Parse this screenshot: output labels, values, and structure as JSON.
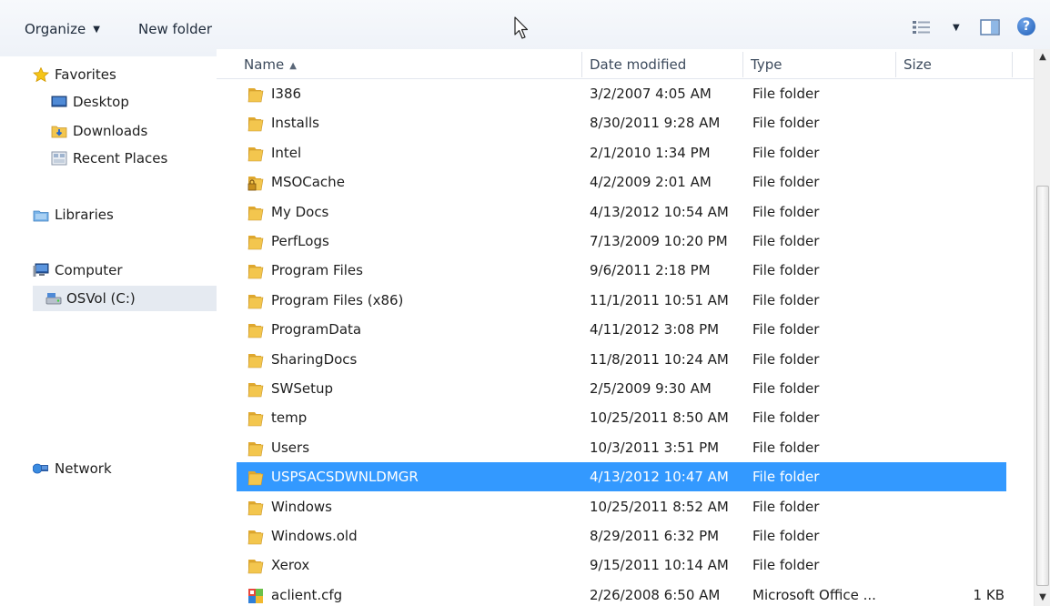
{
  "toolbar": {
    "organize_label": "Organize",
    "new_folder_label": "New folder"
  },
  "nav": {
    "favorites": "Favorites",
    "desktop": "Desktop",
    "downloads": "Downloads",
    "recent_places": "Recent Places",
    "libraries": "Libraries",
    "computer": "Computer",
    "osvol": "OSVol (C:)",
    "network": "Network"
  },
  "columns": {
    "name": "Name",
    "date": "Date modified",
    "type": "Type",
    "size": "Size"
  },
  "files": [
    {
      "name": "I386",
      "date": "3/2/2007 4:05 AM",
      "type": "File folder",
      "size": "",
      "icon": "folder-icon"
    },
    {
      "name": "Installs",
      "date": "8/30/2011 9:28 AM",
      "type": "File folder",
      "size": "",
      "icon": "folder-icon"
    },
    {
      "name": "Intel",
      "date": "2/1/2010 1:34 PM",
      "type": "File folder",
      "size": "",
      "icon": "folder-icon"
    },
    {
      "name": "MSOCache",
      "date": "4/2/2009 2:01 AM",
      "type": "File folder",
      "size": "",
      "icon": "locked-folder-icon"
    },
    {
      "name": "My Docs",
      "date": "4/13/2012 10:54 AM",
      "type": "File folder",
      "size": "",
      "icon": "folder-icon"
    },
    {
      "name": "PerfLogs",
      "date": "7/13/2009 10:20 PM",
      "type": "File folder",
      "size": "",
      "icon": "folder-icon"
    },
    {
      "name": "Program Files",
      "date": "9/6/2011 2:18 PM",
      "type": "File folder",
      "size": "",
      "icon": "folder-icon"
    },
    {
      "name": "Program Files (x86)",
      "date": "11/1/2011 10:51 AM",
      "type": "File folder",
      "size": "",
      "icon": "folder-icon"
    },
    {
      "name": "ProgramData",
      "date": "4/11/2012 3:08 PM",
      "type": "File folder",
      "size": "",
      "icon": "folder-icon"
    },
    {
      "name": "SharingDocs",
      "date": "11/8/2011 10:24 AM",
      "type": "File folder",
      "size": "",
      "icon": "folder-icon"
    },
    {
      "name": "SWSetup",
      "date": "2/5/2009 9:30 AM",
      "type": "File folder",
      "size": "",
      "icon": "folder-icon"
    },
    {
      "name": "temp",
      "date": "10/25/2011 8:50 AM",
      "type": "File folder",
      "size": "",
      "icon": "folder-icon"
    },
    {
      "name": "Users",
      "date": "10/3/2011 3:51 PM",
      "type": "File folder",
      "size": "",
      "icon": "folder-icon"
    },
    {
      "name": "USPSACSDWNLDMGR",
      "date": "4/13/2012 10:47 AM",
      "type": "File folder",
      "size": "",
      "icon": "folder-icon",
      "selected": true
    },
    {
      "name": "Windows",
      "date": "10/25/2011 8:52 AM",
      "type": "File folder",
      "size": "",
      "icon": "folder-icon"
    },
    {
      "name": "Windows.old",
      "date": "8/29/2011 6:32 PM",
      "type": "File folder",
      "size": "",
      "icon": "folder-icon"
    },
    {
      "name": "Xerox",
      "date": "9/15/2011 10:14 AM",
      "type": "File folder",
      "size": "",
      "icon": "folder-icon"
    },
    {
      "name": "aclient.cfg",
      "date": "2/26/2008 6:50 AM",
      "type": "Microsoft Office ...",
      "size": "1 KB",
      "icon": "config-file-icon"
    }
  ],
  "colors": {
    "selection": "#3399ff",
    "folder": "#f3c64e"
  }
}
